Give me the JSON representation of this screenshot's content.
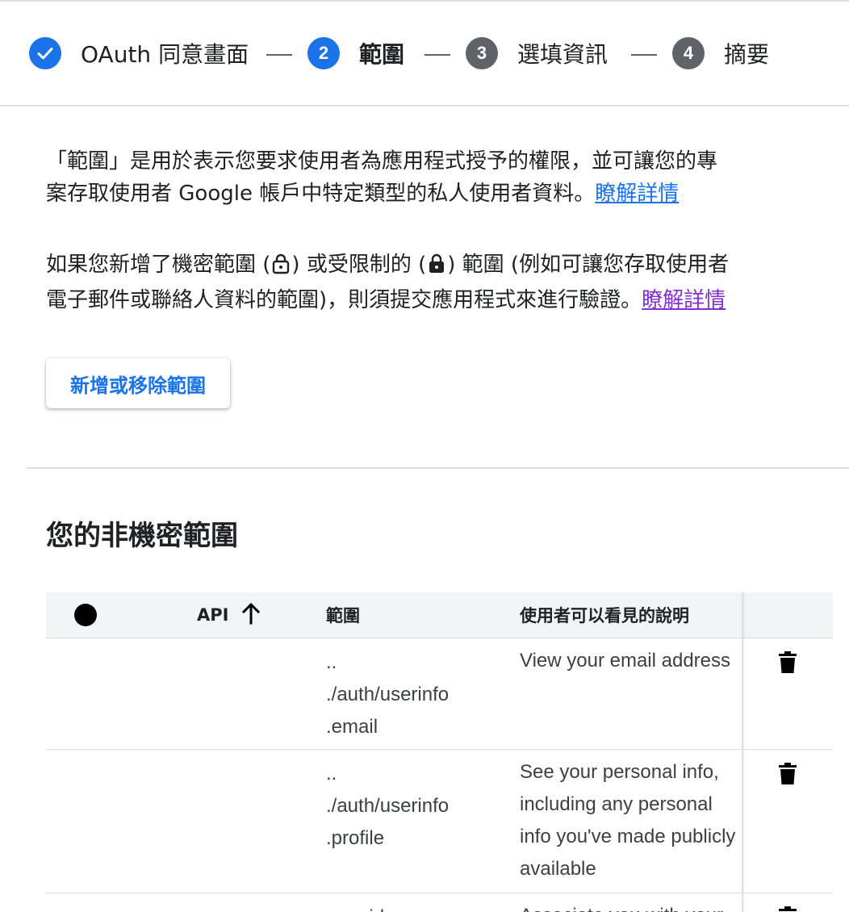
{
  "stepper": {
    "steps": [
      {
        "number": "",
        "label": "OAuth 同意畫面",
        "state": "done"
      },
      {
        "number": "2",
        "label": "範圍",
        "state": "active"
      },
      {
        "number": "3",
        "label": "選填資訊",
        "state": "pending"
      },
      {
        "number": "4",
        "label": "摘要",
        "state": "pending"
      }
    ]
  },
  "intro": {
    "line1": "「範圍」是用於表示您要求使用者為應用程式授予的權限，並可讓您的專",
    "line2": "案存取使用者 Google 帳戶中特定類型的私人使用者資料。",
    "link": "瞭解詳情"
  },
  "sensitive": {
    "line1_a": "如果您新增了機密範圍 (",
    "line1_b": ") 或受限制的 (",
    "line1_c": ") 範圍 (例如可讓您存取使用者",
    "line2": "電子郵件或聯絡人資料的範圍)，則須提交應用程式來進行驗證。",
    "link": "瞭解詳情"
  },
  "add_button": "新增或移除範圍",
  "section_title": "您的非機密範圍",
  "table": {
    "headers": {
      "api": "API",
      "scope": "範圍",
      "description": "使用者可以看見的說明"
    },
    "rows": [
      {
        "scope_lines": [
          "..",
          "./auth/userinfo",
          ".email"
        ],
        "description_lines": [
          "View your email address"
        ]
      },
      {
        "scope_lines": [
          "..",
          "./auth/userinfo",
          ".profile"
        ],
        "description_lines": [
          "See your personal info,",
          "including any personal",
          "info you've made publicly",
          "available"
        ]
      },
      {
        "scope_lines": [
          "openid"
        ],
        "description_lines": [
          "Associate you with your"
        ]
      }
    ]
  },
  "icons": {
    "step_done": "check-icon",
    "sort": "arrow-up-icon",
    "delete": "trash-icon",
    "sensitive": "lock-open-icon",
    "restricted": "lock-icon"
  },
  "colors": {
    "accent": "#1a73e8",
    "pending": "#5f6368",
    "visited_link": "#8430ce"
  }
}
